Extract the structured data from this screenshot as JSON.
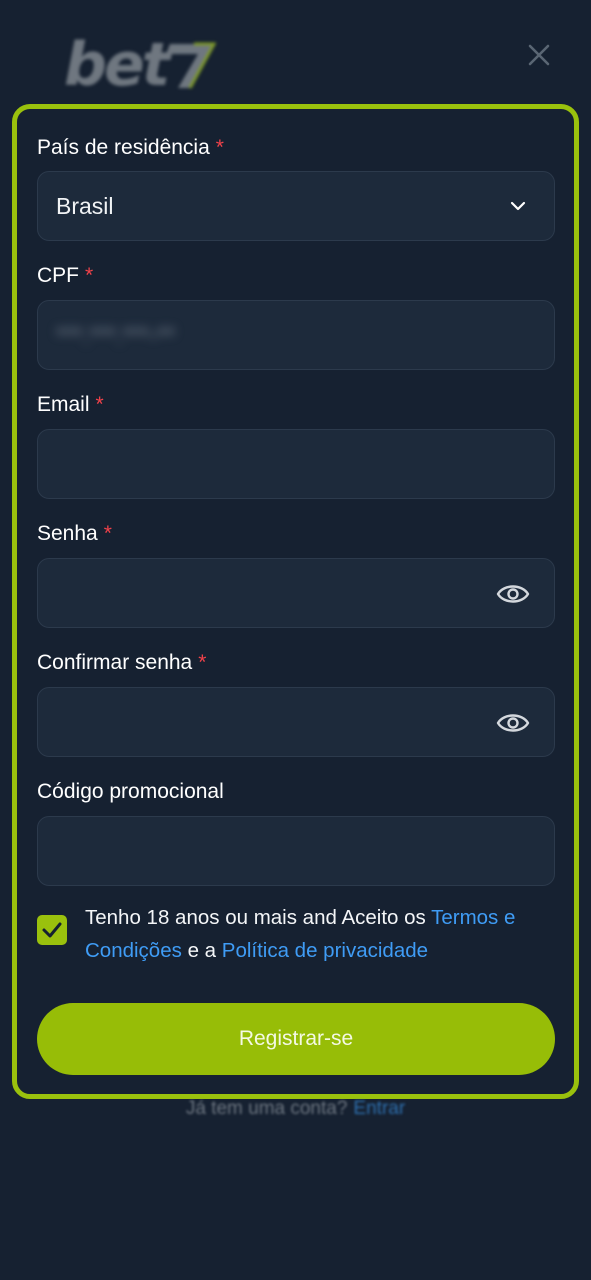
{
  "brand": {
    "logo_text": "bet7",
    "accent_color": "#9ac10d",
    "link_color": "#3f9cf5",
    "required_color": "#f0424a"
  },
  "header": {
    "close_icon": "close-icon"
  },
  "form": {
    "country": {
      "label": "País de residência",
      "required_mark": "*",
      "value": "Brasil",
      "icon": "chevron-down-icon"
    },
    "cpf": {
      "label": "CPF",
      "required_mark": "*",
      "value": "***.***.***-**"
    },
    "email": {
      "label": "Email",
      "required_mark": "*",
      "value": ""
    },
    "password": {
      "label": "Senha",
      "required_mark": "*",
      "value": "",
      "icon": "eye-icon"
    },
    "confirm_password": {
      "label": "Confirmar senha",
      "required_mark": "*",
      "value": "",
      "icon": "eye-icon"
    },
    "promo_code": {
      "label": "Código promocional",
      "value": ""
    },
    "consent": {
      "checked": true,
      "text_prefix": "Tenho 18 anos ou mais and Aceito os ",
      "terms_link": "Termos e Condições",
      "text_middle": " e a ",
      "privacy_link": "Política de privacidade"
    },
    "submit_label": "Registrar-se"
  },
  "footer": {
    "question": "Já tem uma conta?",
    "login_link": "Entrar"
  }
}
